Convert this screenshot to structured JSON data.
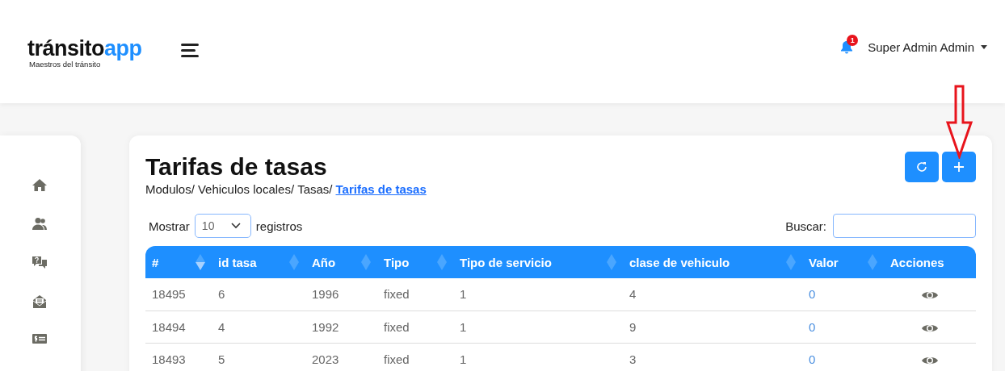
{
  "header": {
    "logo": {
      "word": "tránsito",
      "accent": "app",
      "tagline": "Maestros del tránsito"
    },
    "notifications": {
      "count": "1"
    },
    "user": {
      "name": "Super Admin Admin"
    }
  },
  "page": {
    "title": "Tarifas de tasas",
    "breadcrumb": [
      {
        "label": "Modulos/",
        "current": false
      },
      {
        "label": "Vehiculos locales/",
        "current": false
      },
      {
        "label": "Tasas/",
        "current": false
      },
      {
        "label": "Tarifas de tasas",
        "current": true
      }
    ],
    "buttons": [
      {
        "kind": "refresh"
      },
      {
        "kind": "add"
      }
    ]
  },
  "table_controls": {
    "show_label": "Mostrar",
    "page_size": "10",
    "records_label": "registros",
    "search_label": "Buscar:"
  },
  "table": {
    "columns": [
      {
        "label": "#",
        "sorted": true,
        "kind": "text"
      },
      {
        "label": "id tasa",
        "sorted": false,
        "kind": "text"
      },
      {
        "label": "Año",
        "sorted": false,
        "kind": "text"
      },
      {
        "label": "Tipo",
        "sorted": false,
        "kind": "text"
      },
      {
        "label": "Tipo de servicio",
        "sorted": false,
        "kind": "text"
      },
      {
        "label": "clase de vehiculo",
        "sorted": false,
        "kind": "text"
      },
      {
        "label": "Valor",
        "sorted": false,
        "kind": "value"
      },
      {
        "label": "Acciones",
        "kind": "action"
      }
    ],
    "rows": [
      [
        "18495",
        "6",
        "1996",
        "fixed",
        "1",
        "4",
        "0"
      ],
      [
        "18494",
        "4",
        "1992",
        "fixed",
        "1",
        "9",
        "0"
      ],
      [
        "18493",
        "5",
        "2023",
        "fixed",
        "1",
        "3",
        "0"
      ]
    ]
  },
  "annotation": {
    "kind": "arrow"
  }
}
